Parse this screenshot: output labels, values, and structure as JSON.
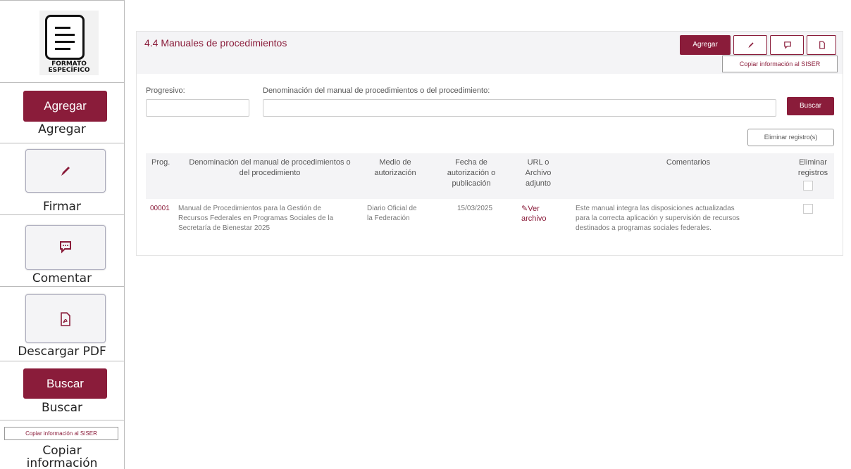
{
  "legend": {
    "logo_text_1": "FORMATO",
    "logo_text_2": "ESPECÍFICO",
    "agregar_button": "Agregar",
    "agregar_label": "Agregar",
    "firmar_label": "Firmar",
    "comentar_label": "Comentar",
    "pdf_label": "Descargar PDF",
    "buscar_button": "Buscar",
    "buscar_label": "Buscar",
    "copiar_button": "Copiar información al SISER",
    "copiar_label_1": "Copiar",
    "copiar_label_2": "información"
  },
  "main": {
    "title": "4.4 Manuales de procedimientos",
    "agregar": "Agregar",
    "copiar": "Copiar información al SISER",
    "progresivo_label": "Progresivo:",
    "denominacion_label": "Denominación del manual de procedimientos o del procedimiento:",
    "progresivo_value": "",
    "denominacion_value": "",
    "buscar": "Buscar",
    "eliminar": "Eliminar registro(s)"
  },
  "table": {
    "headers": {
      "prog": "Prog.",
      "denominacion_1": "Denominación del manual de procedimientos o",
      "denominacion_2": "del procedimiento",
      "medio_1": "Medio de",
      "medio_2": "autorización",
      "fecha_1": "Fecha de",
      "fecha_2": "autorización o",
      "fecha_3": "publicación",
      "url_1": "URL o",
      "url_2": "Archivo",
      "url_3": "adjunto",
      "comentarios": "Comentarios",
      "eliminar_1": "Eliminar",
      "eliminar_2": "registros"
    },
    "row": {
      "prog": "00001",
      "den_1": "Manual de Procedimientos para la Gestión de",
      "den_2": "Recursos Federales en Programas Sociales de la",
      "den_3": "Secretaría de Bienestar 2025",
      "medio_1": "Diario Oficial de",
      "medio_2": "la Federación",
      "fecha": "15/03/2025",
      "url_1": "Ver",
      "url_2": "archivo",
      "com_1": "Este manual integra las disposiciones actualizadas",
      "com_2": "para la correcta aplicación y supervisión de recursos",
      "com_3": "destinados a programas sociales federales."
    }
  },
  "colors": {
    "accent": "#8a1c3a",
    "header_bg": "#f4f4f6"
  }
}
